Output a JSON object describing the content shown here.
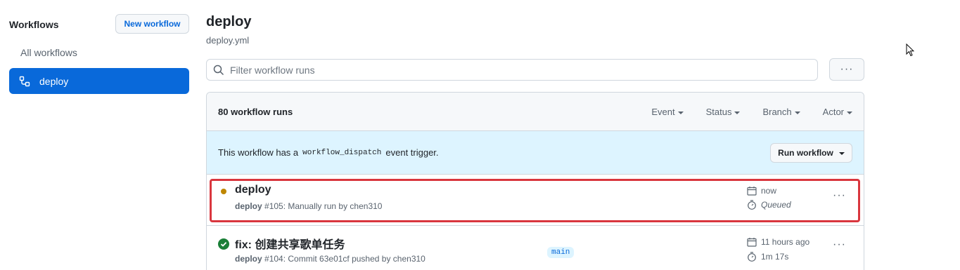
{
  "sidebar": {
    "title": "Workflows",
    "new_workflow_label": "New workflow",
    "all_workflows_label": "All workflows",
    "selected_workflow_label": "deploy"
  },
  "header": {
    "title": "deploy",
    "file": "deploy.yml"
  },
  "filter": {
    "placeholder": "Filter workflow runs",
    "more_label": "···"
  },
  "runs": {
    "count_label": "80 workflow runs",
    "filters": [
      "Event",
      "Status",
      "Branch",
      "Actor"
    ]
  },
  "banner": {
    "text_before": "This workflow has a",
    "code": "workflow_dispatch",
    "text_after": "event trigger.",
    "button_label": "Run workflow"
  },
  "run_items": [
    {
      "title": "deploy",
      "workflow": "deploy",
      "description": "#105: Manually run by chen310",
      "time": "now",
      "duration": "Queued",
      "status": "queued",
      "more_label": "···"
    },
    {
      "title": "fix: 创建共享歌单任务",
      "workflow": "deploy",
      "description": "#104: Commit 63e01cf pushed by chen310",
      "branch": "main",
      "time": "11 hours ago",
      "duration": "1m 17s",
      "status": "success",
      "more_label": "···"
    }
  ],
  "colors": {
    "accent": "#0969da",
    "queued": "#bf8700",
    "success": "#1a7f37",
    "highlight": "#d9363e",
    "banner_bg": "#ddf4ff"
  }
}
